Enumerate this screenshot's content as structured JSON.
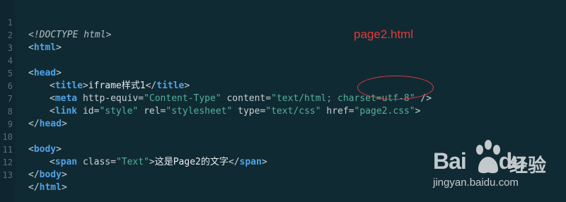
{
  "editor": {
    "line_numbers": [
      "1",
      "2",
      "3",
      "4",
      "5",
      "6",
      "7",
      "8",
      "9",
      "10",
      "11",
      "12",
      "13"
    ],
    "lines": {
      "l1": {
        "text": "<!DOCTYPE html>"
      },
      "l2": {
        "lt": "<",
        "tag": "html",
        "gt": ">"
      },
      "l4": {
        "lt": "<",
        "tag": "head",
        "gt": ">"
      },
      "l5": {
        "lt": "<",
        "tag": "title",
        "gt": ">",
        "content": "iframe样式1",
        "close_lt": "</",
        "close_tag": "title",
        "close_gt": ">"
      },
      "l6": {
        "lt": "<",
        "tag": "meta",
        "a1": " http-equiv=",
        "v1": "\"Content-Type\"",
        "a2": " content=",
        "v2": "\"text/html; charset=utf-8\"",
        "end": " />"
      },
      "l7": {
        "lt": "<",
        "tag": "link",
        "a1": " id=",
        "v1": "\"style\"",
        "a2": " rel=",
        "v2": "\"stylesheet\"",
        "a3": " type=",
        "v3": "\"text/css\"",
        "a4": " href=",
        "v4": "\"page2.css\"",
        "gt": ">"
      },
      "l8": {
        "lt": "</",
        "tag": "head",
        "gt": ">"
      },
      "l10": {
        "lt": "<",
        "tag": "body",
        "gt": ">"
      },
      "l11": {
        "lt": "<",
        "tag": "span",
        "a1": " class=",
        "v1": "\"Text\"",
        "gt": ">",
        "content": "这是Page2的文字",
        "close_lt": "</",
        "close_tag": "span",
        "close_gt": ">"
      },
      "l12": {
        "lt": "</",
        "tag": "body",
        "gt": ">"
      },
      "l13": {
        "lt": "</",
        "tag": "html",
        "gt": ">"
      }
    }
  },
  "annotation": {
    "label": "page2.html",
    "color": "#e03b3b"
  },
  "watermark": {
    "logo_text_left": "Bai",
    "logo_text_right": "du",
    "product": "经验",
    "url": "jingyan.baidu.com"
  },
  "colors": {
    "background": "#102a33",
    "tag": "#4fa3e8",
    "string": "#54b19a",
    "text": "#c9d1d3",
    "line_number": "#56707a",
    "annotation": "#e03b3b"
  }
}
